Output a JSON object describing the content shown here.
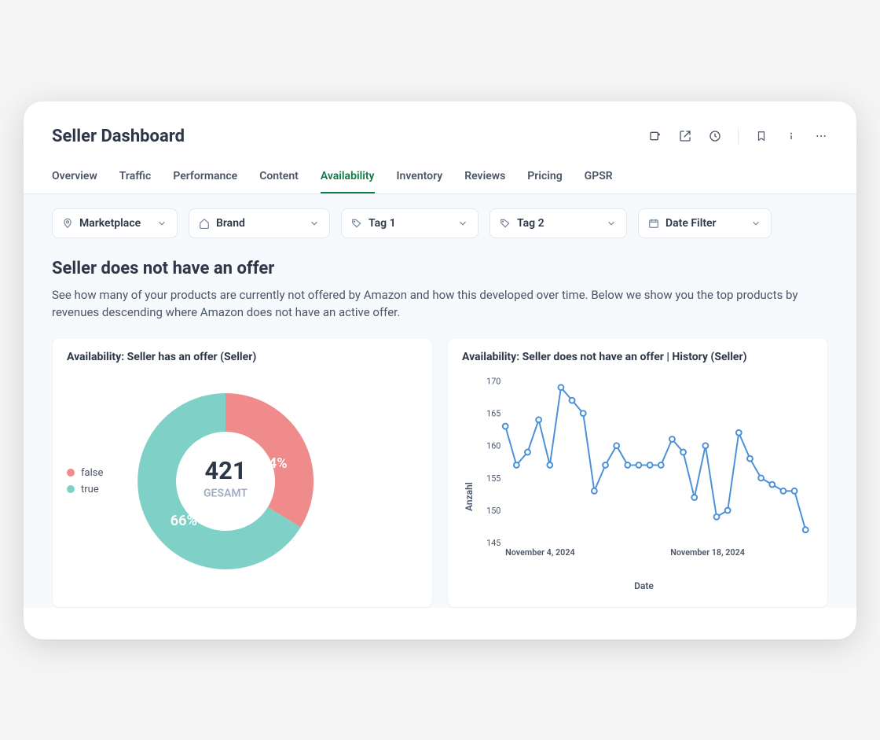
{
  "header": {
    "title": "Seller Dashboard"
  },
  "tabs": [
    {
      "label": "Overview",
      "active": false
    },
    {
      "label": "Traffic",
      "active": false
    },
    {
      "label": "Performance",
      "active": false
    },
    {
      "label": "Content",
      "active": false
    },
    {
      "label": "Availability",
      "active": true
    },
    {
      "label": "Inventory",
      "active": false
    },
    {
      "label": "Reviews",
      "active": false
    },
    {
      "label": "Pricing",
      "active": false
    },
    {
      "label": "GPSR",
      "active": false
    }
  ],
  "filters": {
    "marketplace": "Marketplace",
    "brand": "Brand",
    "tag1": "Tag 1",
    "tag2": "Tag 2",
    "date": "Date Filter"
  },
  "section": {
    "title": "Seller does not have an offer",
    "desc": "See how many of your products are currently not offered by Amazon and how this developed over time. Below we show you the top products by revenues descending where Amazon does not have an active offer."
  },
  "charts": {
    "donut": {
      "title": "Availability: Seller has an offer (Seller)",
      "center_value": "421",
      "center_label": "GESAMT",
      "pct_false_label": "34%",
      "pct_true_label": "66%",
      "legend_false": "false",
      "legend_true": "true"
    },
    "line": {
      "title": "Availability: Seller does not have an offer | History (Seller)",
      "ylabel": "Anzahl",
      "xlabel": "Date",
      "xtick1": "November 4, 2024",
      "xtick2": "November 18, 2024"
    }
  },
  "chart_data": [
    {
      "type": "pie",
      "title": "Availability: Seller has an offer (Seller)",
      "total": 421,
      "total_label": "GESAMT",
      "series": [
        {
          "name": "false",
          "value": 143,
          "pct": 34,
          "color": "#ef8b8b"
        },
        {
          "name": "true",
          "value": 278,
          "pct": 66,
          "color": "#7fd1c7"
        }
      ]
    },
    {
      "type": "line",
      "title": "Availability: Seller does not have an offer | History (Seller)",
      "xlabel": "Date",
      "ylabel": "Anzahl",
      "ylim": [
        145,
        170
      ],
      "x_ticks": [
        "November 4, 2024",
        "November 18, 2024"
      ],
      "y_ticks": [
        145,
        150,
        155,
        160,
        165,
        170
      ],
      "values": [
        163,
        157,
        159,
        164,
        157,
        169,
        167,
        165,
        153,
        157,
        160,
        157,
        157,
        157,
        157,
        161,
        159,
        152,
        160,
        149,
        150,
        162,
        158,
        155,
        154,
        153,
        153,
        147
      ]
    }
  ]
}
